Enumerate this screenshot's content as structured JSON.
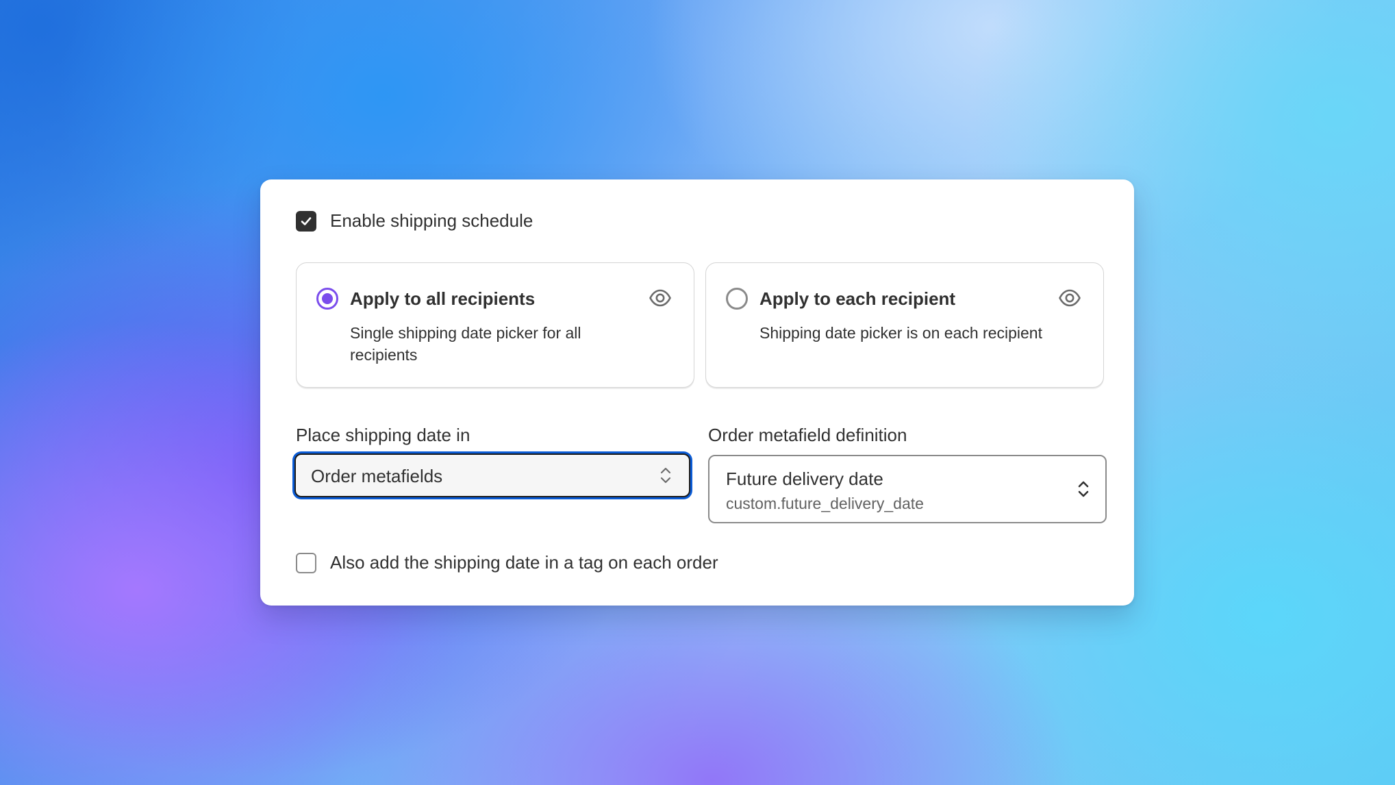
{
  "enable_schedule": {
    "label": "Enable shipping schedule",
    "checked": true,
    "icon": "checkmark-icon"
  },
  "options": [
    {
      "title": "Apply to all recipients",
      "description": "Single shipping date picker for all recipients",
      "selected": true,
      "icon": "eye-icon"
    },
    {
      "title": "Apply to each recipient",
      "description": "Shipping date picker is on each recipient",
      "selected": false,
      "icon": "eye-icon"
    }
  ],
  "place_date": {
    "label": "Place shipping date in",
    "value": "Order metafields",
    "icon": "select-chevron-icon"
  },
  "metafield_definition": {
    "label": "Order metafield definition",
    "value": "Future delivery date",
    "subvalue": "custom.future_delivery_date",
    "icon": "select-chevron-icon"
  },
  "add_tag": {
    "label": "Also add the shipping date in a tag on each order",
    "checked": false
  },
  "colors": {
    "accent_radio": "#7b4dec",
    "focus_ring": "#0b5cd6",
    "checkbox_fill": "#303030"
  }
}
